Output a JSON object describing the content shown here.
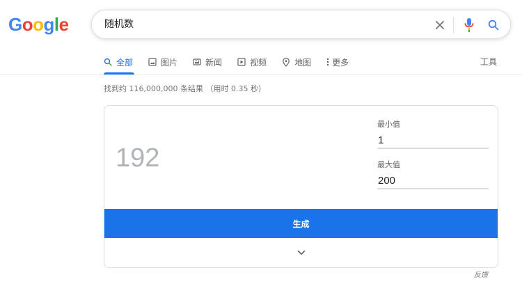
{
  "logo": {
    "letters": [
      "G",
      "o",
      "o",
      "g",
      "l",
      "e"
    ],
    "colors": [
      "#4285F4",
      "#EA4335",
      "#FBBC05",
      "#4285F4",
      "#34A853",
      "#EA4335"
    ]
  },
  "search": {
    "query": "随机数",
    "clear_icon": "close-icon",
    "voice_icon": "microphone-icon",
    "search_icon": "search-icon"
  },
  "tabs": [
    {
      "label": "全部",
      "icon": "search-icon",
      "active": true
    },
    {
      "label": "图片",
      "icon": "image-icon",
      "active": false
    },
    {
      "label": "新闻",
      "icon": "newspaper-icon",
      "active": false
    },
    {
      "label": "视频",
      "icon": "play-icon",
      "active": false
    },
    {
      "label": "地图",
      "icon": "map-pin-icon",
      "active": false
    },
    {
      "label": "更多",
      "icon": "more-vertical-icon",
      "active": false
    }
  ],
  "tools_label": "工具",
  "stats": "找到约 116,000,000 条结果 （用时 0.35 秒）",
  "rng": {
    "result": "192",
    "min_label": "最小值",
    "min_value": "1",
    "max_label": "最大值",
    "max_value": "200",
    "generate_label": "生成",
    "expand_icon": "chevron-down-icon"
  },
  "feedback_label": "反馈",
  "colors": {
    "accent": "#1a73e8",
    "mic_blue": "#4285F4",
    "mic_red": "#EA4335",
    "mic_yellow": "#FBBC05",
    "mic_green": "#34A853"
  }
}
